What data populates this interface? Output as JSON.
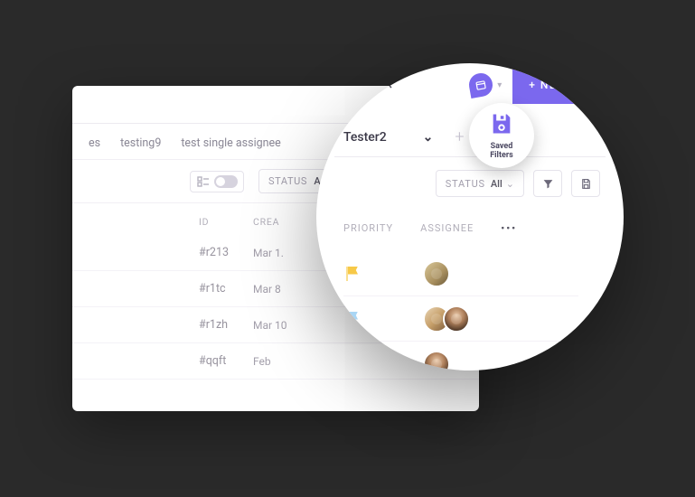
{
  "background": {
    "toolbar": {
      "search_icon": "search",
      "calendar_icon": "calendar-check"
    },
    "tabs": [
      "es",
      "testing9",
      "test single assignee"
    ],
    "layout": {
      "status_label": "STATUS",
      "status_value": "All"
    },
    "columns": {
      "id": "ID",
      "created": "CREA"
    },
    "rows": [
      {
        "id": "#r213",
        "created": "Mar 1."
      },
      {
        "id": "#r1tc",
        "created": "Mar 8"
      },
      {
        "id": "#r1zh",
        "created": "Mar 10"
      },
      {
        "id": "#qqft",
        "created": "Feb"
      }
    ]
  },
  "zoom": {
    "new_task_label": "+ NEW TASK",
    "tab_selected": "Tester2",
    "add_tab": "+",
    "status_label": "STATUS",
    "status_value": "All",
    "columns": {
      "priority": "PRIORITY",
      "assignee": "ASSIGNEE",
      "more": "•••"
    },
    "rows": [
      {
        "priority": "yellow",
        "assignees": 1
      },
      {
        "priority": "blue",
        "assignees": 2
      },
      {
        "priority": "none",
        "assignees": 1
      }
    ]
  },
  "callout": {
    "label_line1": "Saved",
    "label_line2": "Filters"
  },
  "colors": {
    "accent": "#7b68ee"
  }
}
